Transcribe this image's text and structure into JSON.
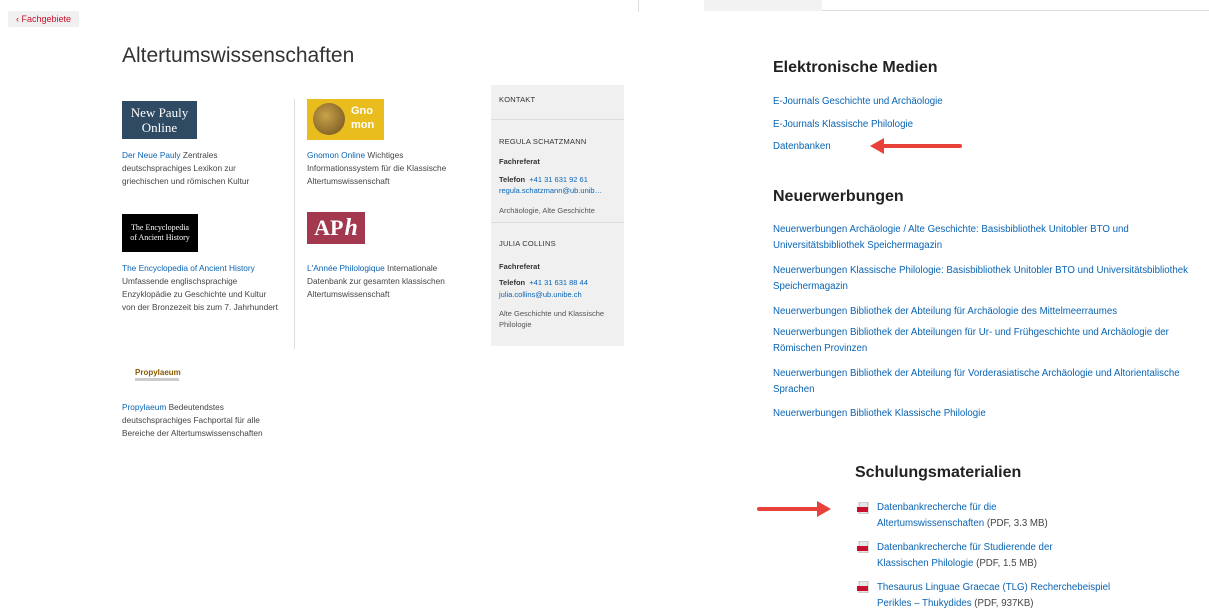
{
  "back_button": {
    "label": "‹ Fachgebiete"
  },
  "page": {
    "title": "Altertumswissenschaften"
  },
  "resources": [
    {
      "logo_text": [
        "New Pauly",
        "Online"
      ],
      "link": "Der Neue Pauly",
      "desc": " Zentrales deutschsprachiges Lexikon zur griechischen und römischen Kultur"
    },
    {
      "logo_text": [
        "Gno",
        "mon"
      ],
      "link": "Gnomon Online",
      "desc": " Wichtiges Informationssystem für die Klassische Altertumswissenschaft"
    },
    {
      "logo_text": [
        "The Encyclopedia",
        "of Ancient History"
      ],
      "link": "The Encyclopedia of Ancient History",
      "desc": " Umfassende englischsprachige Enzyklopädie zu Geschichte und Kultur von der Bronzezeit bis zum 7. Jahrhundert"
    },
    {
      "logo_text": [
        "AP",
        "h"
      ],
      "link": "L'Année Philologique",
      "desc": " Internationale Datenbank zur gesamten klassischen Altertumswissenschaft"
    },
    {
      "logo_text": [
        "Propylaeum"
      ],
      "link": "Propylaeum",
      "desc": " Bedeutendstes deutschsprachiges Fachportal für alle Bereiche der Altertumswissenschaften"
    }
  ],
  "contact": {
    "heading": "Kontakt",
    "people": [
      {
        "name": "Regula Schatzmann",
        "role": "Fachreferat",
        "phone_label": "Telefon",
        "phone": "+41 31 631 92 61",
        "email": "regula.schatzmann@ub.unib…",
        "areas": "Archäologie, Alte Geschichte"
      },
      {
        "name": "Julia Collins",
        "role": "Fachreferat",
        "phone_label": "Telefon",
        "phone": "+41 31 631 88 44",
        "email": "julia.collins@ub.unibe.ch",
        "areas": "Alte Geschichte und Klassische Philologie"
      }
    ]
  },
  "electronic_media": {
    "heading": "Elektronische Medien",
    "links": [
      "E-Journals Geschichte und Archäologie",
      "E-Journals Klassische Philologie",
      "Datenbanken"
    ]
  },
  "acquisitions": {
    "heading": "Neuerwerbungen",
    "links": [
      "Neuerwerbungen Archäologie / Alte Geschichte: Basisbibliothek Unitobler BTO und Universitätsbibliothek Speichermagazin",
      "Neuerwerbungen Klassische Philologie: Basisbibliothek Unitobler BTO und Universitätsbibliothek Speichermagazin",
      "Neuerwerbungen Bibliothek der Abteilung für Archäologie des Mittelmeerraumes",
      "Neuerwerbungen Bibliothek der Abteilungen für Ur- und Frühgeschichte und Archäologie der Römischen Provinzen",
      "Neuerwerbungen Bibliothek der Abteilung für Vorderasiatische Archäologie und Altorientalische Sprachen",
      "Neuerwerbungen Bibliothek Klassische Philologie"
    ]
  },
  "training": {
    "heading": "Schulungsmaterialien",
    "items": [
      {
        "title": "Datenbankrecherche für die Altertumswissenschaften",
        "meta": " (PDF, 3.3 MB)"
      },
      {
        "title": "Datenbankrecherche für Studierende der Klassischen Philologie",
        "meta": " (PDF, 1.5 MB)"
      },
      {
        "title": "Thesaurus Linguae Graecae (TLG) Recherchebeispiel Perikles – Thukydides",
        "meta": " (PDF, 937KB)"
      }
    ]
  },
  "colors": {
    "link": "#0a64b4",
    "accent_red": "#c8102e",
    "arrow": "#e8413a"
  }
}
